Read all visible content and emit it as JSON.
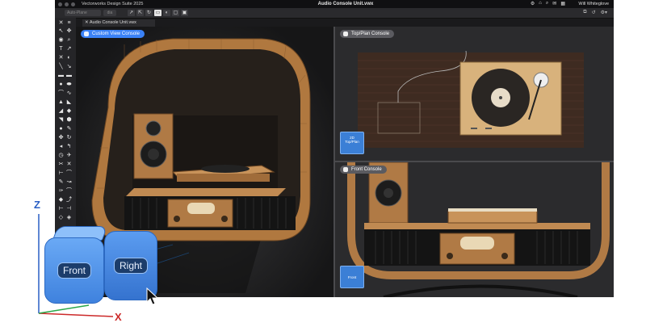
{
  "app": {
    "name": "Vectorworks Design Suite 2025",
    "document_title": "Audio Console Unit.vwx",
    "user": "Will Whiteglove"
  },
  "toolbar": {
    "class_field": "Auto-Plane",
    "layer_field": "dia"
  },
  "tabs": [
    {
      "label": "Audio Console Unit.vwx"
    }
  ],
  "viewports": {
    "custom": {
      "label": "Custom View  Console"
    },
    "top": {
      "label": "Top/Plan  Console",
      "cube_top": "2D",
      "cube_bottom": "Top/Plan"
    },
    "front": {
      "label": "Front  Console",
      "cube": "Front"
    }
  },
  "view_cube": {
    "front": "Front",
    "right": "Right",
    "axis_z": "Z",
    "axis_x": "X"
  },
  "colors": {
    "wood": "#b07a45",
    "accent_blue": "#3b82f6",
    "viewport_bg": "#2a2a2a",
    "plan_bg": "#3e2b21"
  }
}
